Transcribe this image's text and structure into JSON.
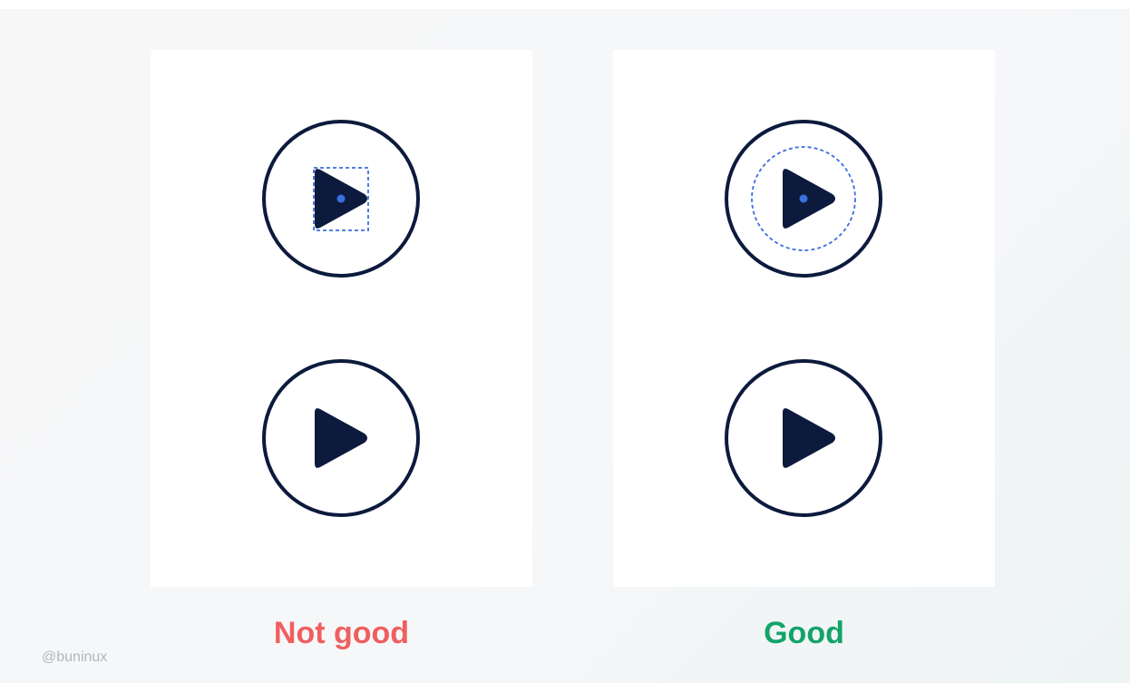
{
  "captions": {
    "bad": "Not good",
    "good": "Good"
  },
  "watermark": "@buninux",
  "colors": {
    "icon": "#0c1a3d",
    "guide": "#3b6fe0",
    "bad_caption": "#ef5f5f",
    "good_caption": "#14a36a"
  },
  "icons": [
    "play-button-icon",
    "play-icon",
    "bounding-box-guide",
    "circle-guide",
    "center-dot"
  ]
}
